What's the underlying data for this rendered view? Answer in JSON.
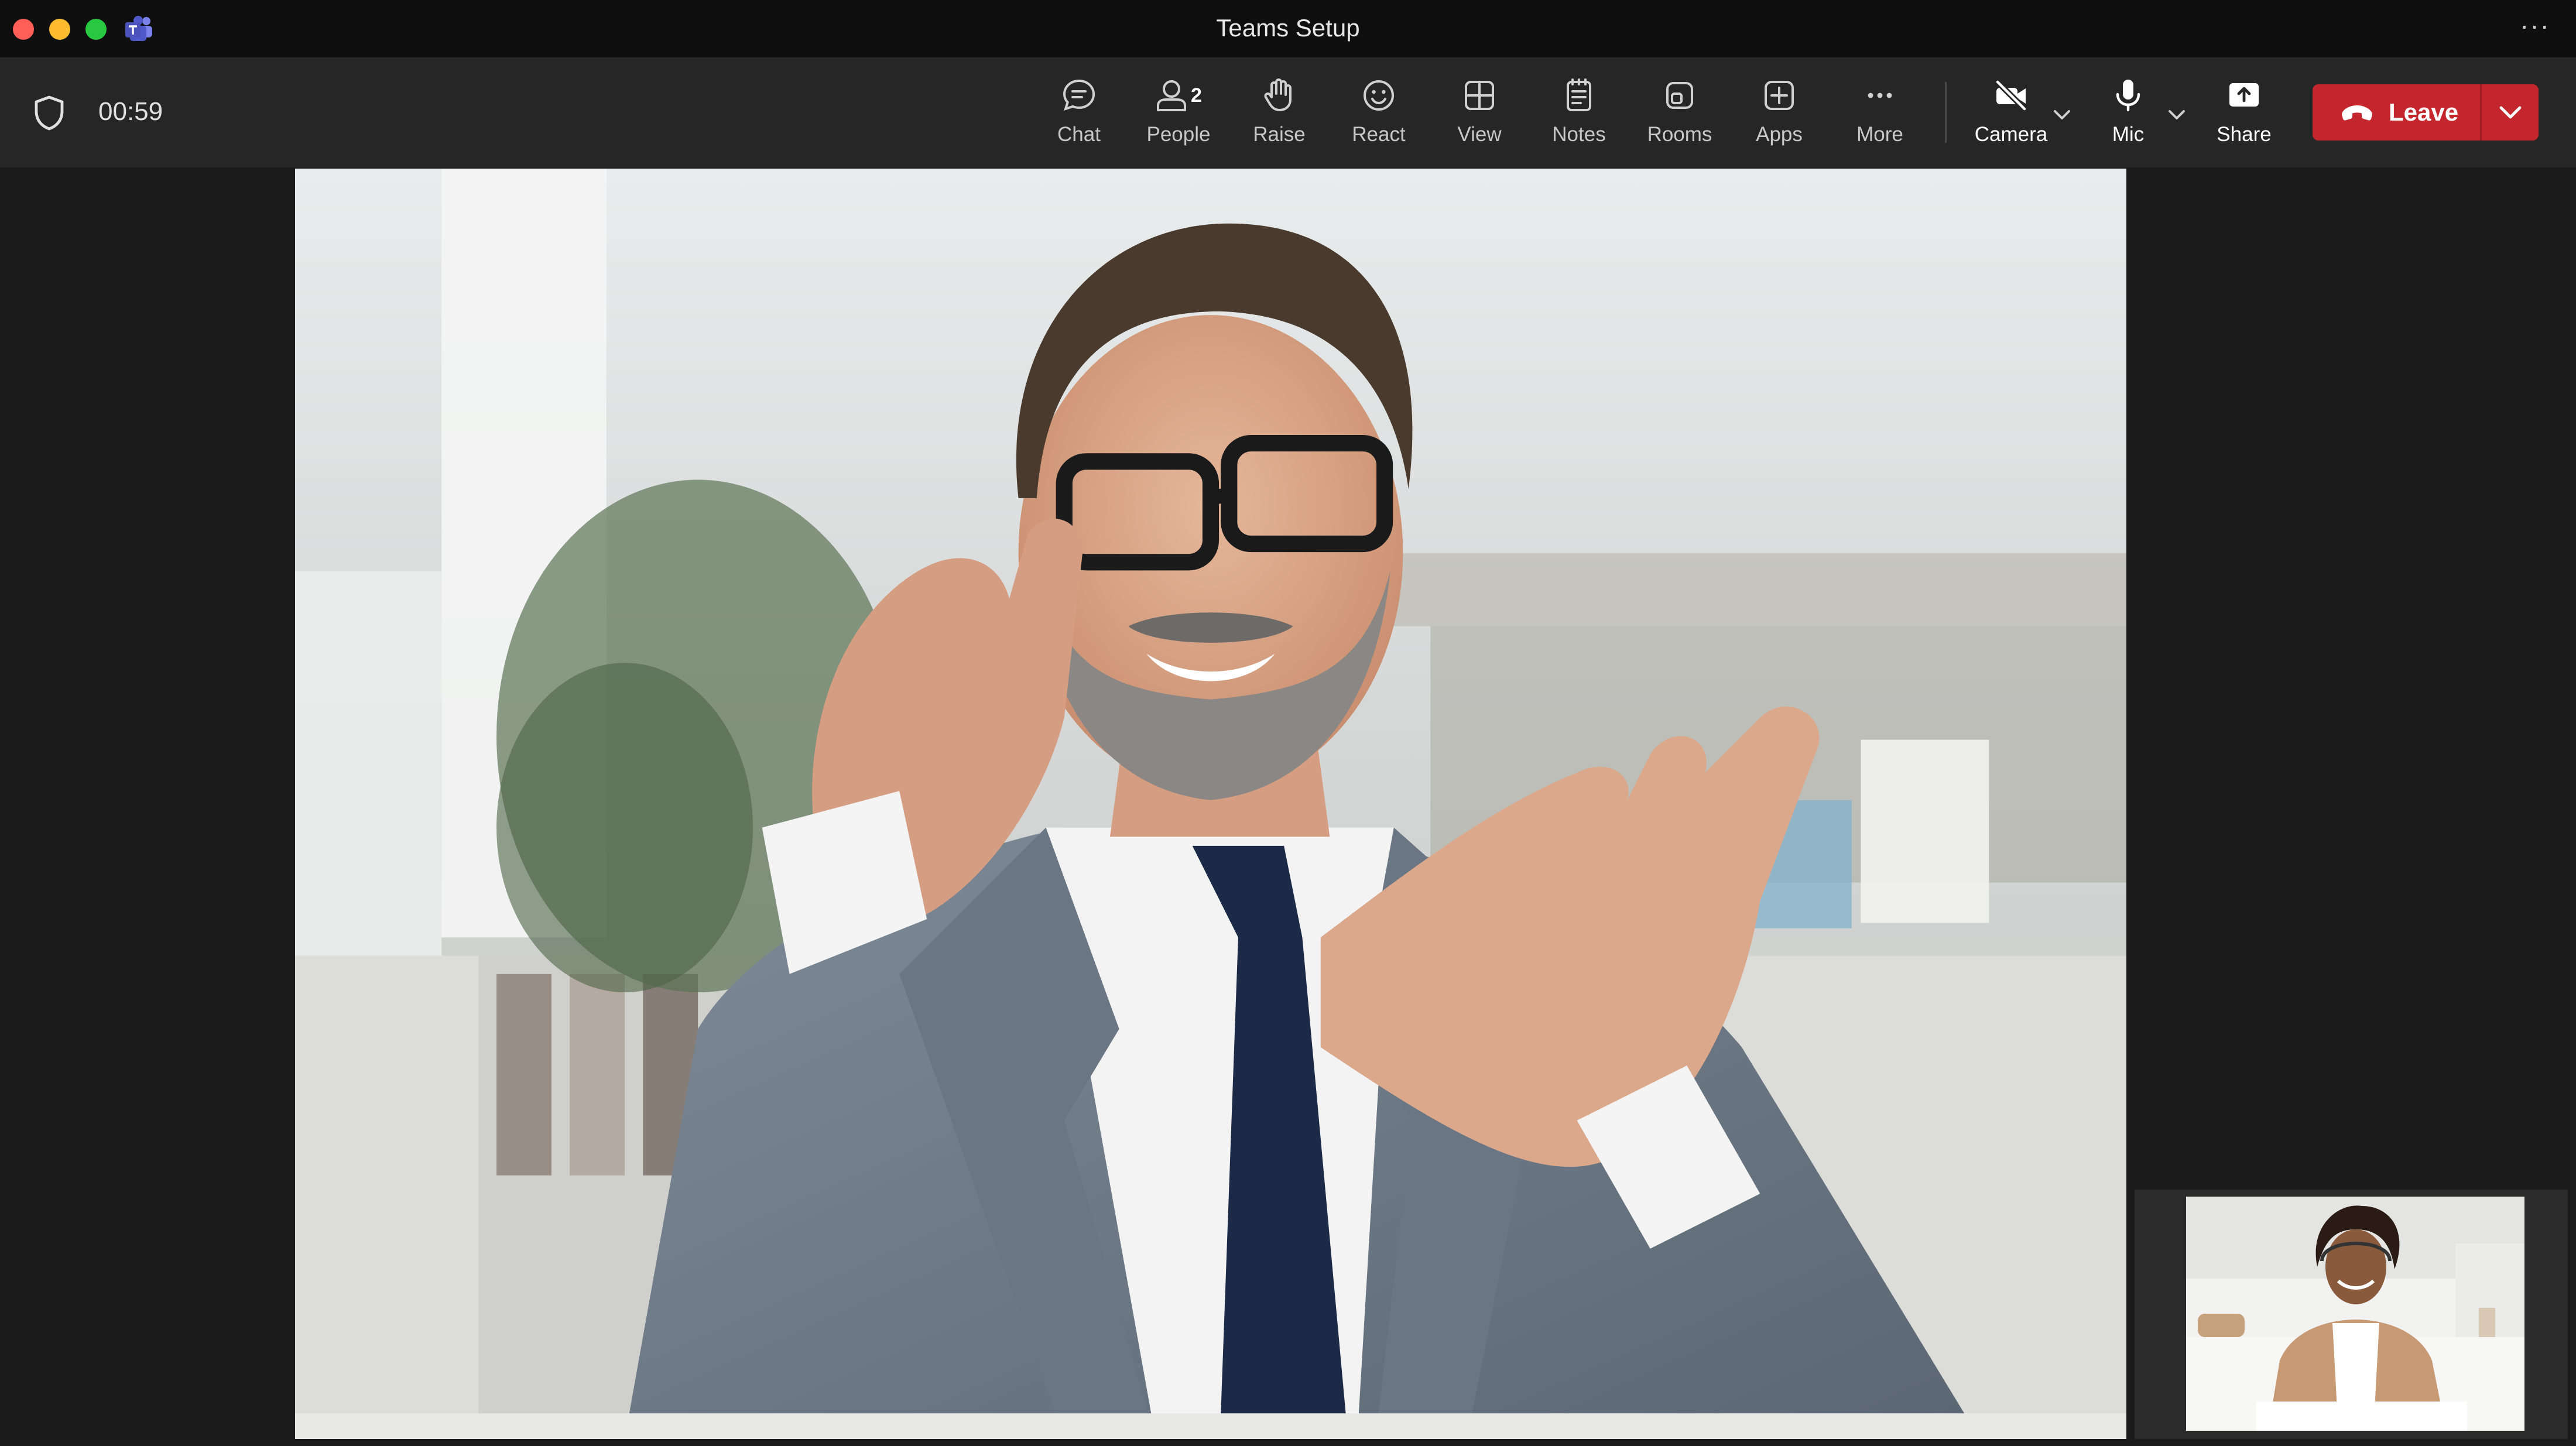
{
  "window": {
    "title": "Teams Setup"
  },
  "meeting": {
    "elapsed": "00:59"
  },
  "toolbar": {
    "chat_label": "Chat",
    "people_label": "People",
    "people_count": "2",
    "raise_label": "Raise",
    "react_label": "React",
    "view_label": "View",
    "notes_label": "Notes",
    "rooms_label": "Rooms",
    "apps_label": "Apps",
    "more_label": "More",
    "camera_label": "Camera",
    "mic_label": "Mic",
    "share_label": "Share",
    "leave_label": "Leave"
  },
  "colors": {
    "leave_button": "#c4262e",
    "toolbar_bg": "#262626",
    "titlebar_bg": "#0f0f0f",
    "stage_bg": "#1b1b1b"
  },
  "icons": {
    "security": "shield-icon",
    "chat": "chat-bubble-icon",
    "people": "person-icon",
    "raise": "hand-icon",
    "react": "smiley-icon",
    "view": "grid-icon",
    "notes": "notes-icon",
    "rooms": "rooms-icon",
    "apps": "plus-square-icon",
    "more": "ellipsis-icon",
    "camera": "camera-off-icon",
    "mic": "microphone-icon",
    "share": "share-upload-icon",
    "leave": "phone-hangup-icon"
  }
}
